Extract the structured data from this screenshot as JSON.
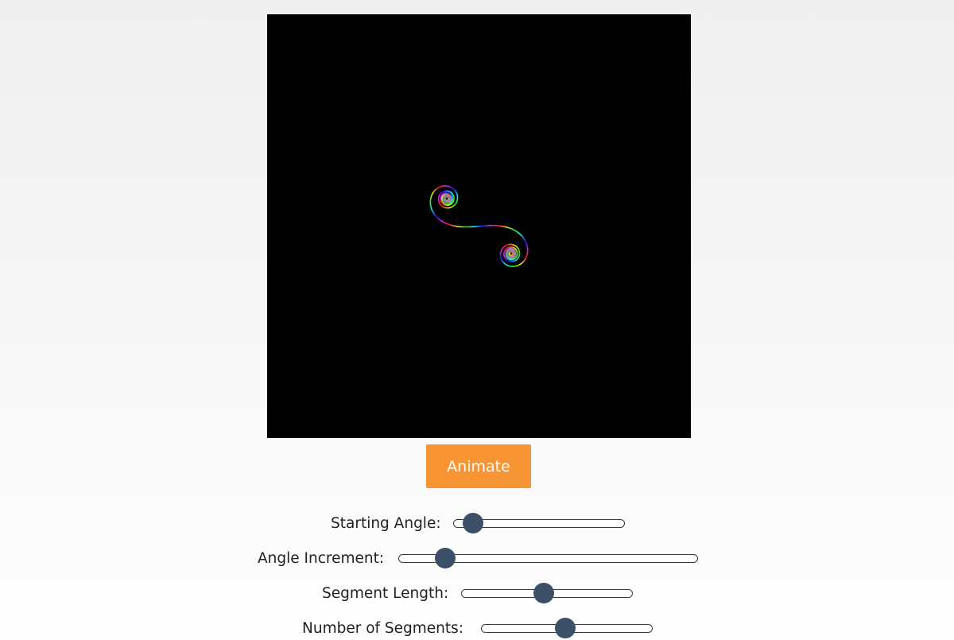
{
  "animate_label": "Animate",
  "colors": {
    "canvas_bg": "#000000",
    "button_bg": "#f79433",
    "slider_thumb": "#3b5066"
  },
  "controls": [
    {
      "label": "Starting Angle:",
      "value": 0.06
    },
    {
      "label": "Angle Increment:",
      "value": 0.13
    },
    {
      "label": "Segment Length:",
      "value": 0.48
    },
    {
      "label": "Number of Segments:",
      "value": 0.49
    }
  ]
}
